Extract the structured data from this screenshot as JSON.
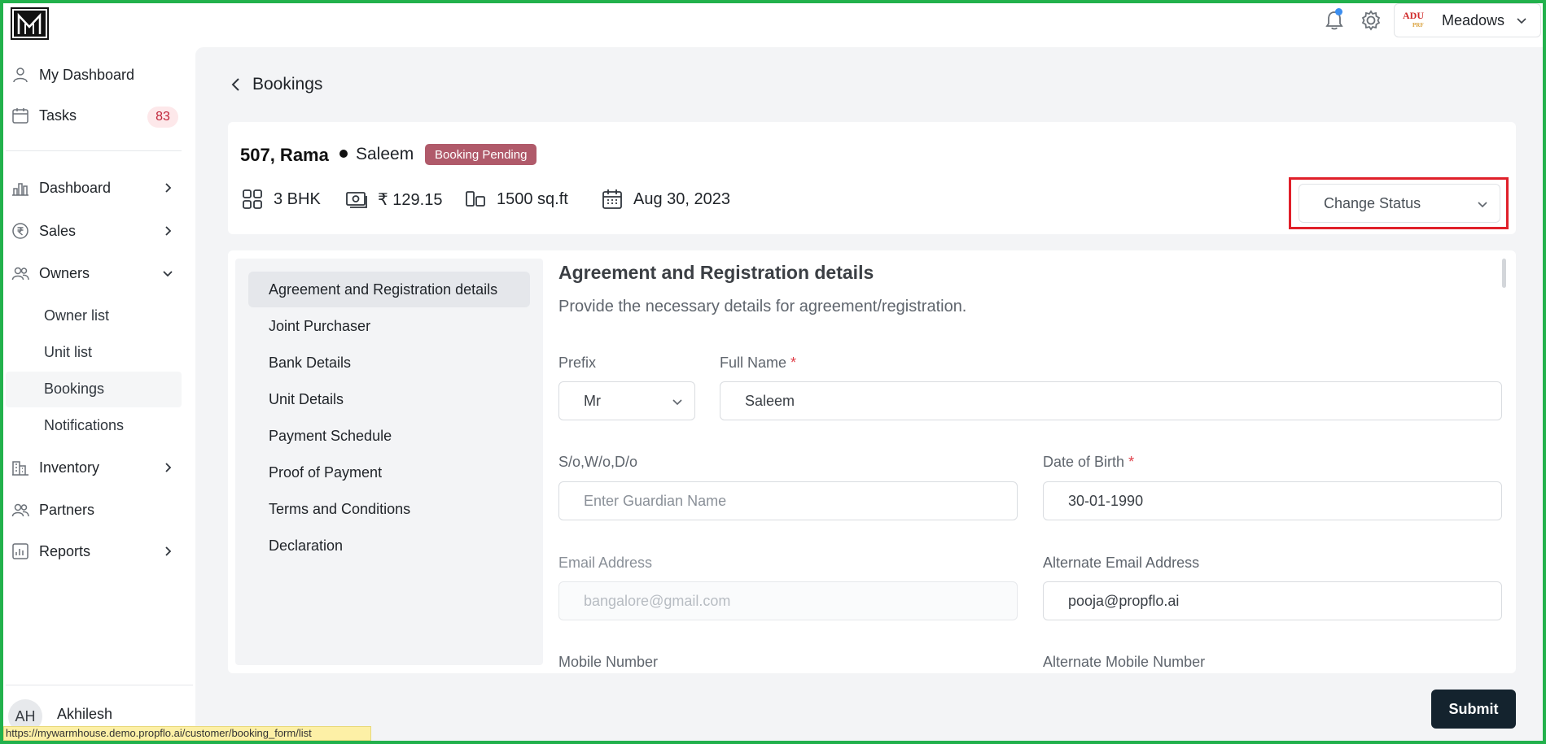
{
  "topbar": {
    "project": {
      "logo_text": "ADU",
      "logo_sub": "PRF",
      "name": "Meadows"
    }
  },
  "sidebar": {
    "my_dashboard": "My Dashboard",
    "tasks": {
      "label": "Tasks",
      "count": "83"
    },
    "items": [
      {
        "label": "Dashboard",
        "icon": "bar-chart-icon"
      },
      {
        "label": "Sales",
        "icon": "rupee-icon"
      },
      {
        "label": "Owners",
        "icon": "users-icon"
      },
      {
        "label": "Inventory",
        "icon": "building-icon"
      },
      {
        "label": "Partners",
        "icon": "users-icon"
      },
      {
        "label": "Reports",
        "icon": "report-icon"
      }
    ],
    "owners_sub": [
      "Owner list",
      "Unit list",
      "Bookings",
      "Notifications"
    ],
    "user": {
      "initials": "AH",
      "name": "Akhilesh"
    },
    "status_url": "https://mywarmhouse.demo.propflo.ai/customer/booking_form/list"
  },
  "page": {
    "title": "Bookings"
  },
  "booking": {
    "unit": "507, Rama",
    "owner": "Saleem",
    "status_badge": "Booking Pending",
    "bhk": "3 BHK",
    "price": "₹ 129.15",
    "area": "1500 sq.ft",
    "date": "Aug 30, 2023",
    "change_status": "Change Status"
  },
  "steps": [
    "Agreement and Registration details",
    "Joint Purchaser",
    "Bank Details",
    "Unit Details",
    "Payment Schedule",
    "Proof of Payment",
    "Terms and Conditions",
    "Declaration"
  ],
  "form": {
    "title": "Agreement and Registration details",
    "subtitle": "Provide the necessary details for agreement/registration.",
    "prefix": {
      "label": "Prefix",
      "value": "Mr"
    },
    "full_name": {
      "label": "Full Name",
      "value": "Saleem"
    },
    "guardian": {
      "label": "S/o,W/o,D/o",
      "placeholder": "Enter Guardian Name"
    },
    "dob": {
      "label": "Date of Birth",
      "value": "30-01-1990"
    },
    "email": {
      "label": "Email Address",
      "value": "bangalore@gmail.com"
    },
    "alt_email": {
      "label": "Alternate Email Address",
      "value": "pooja@propflo.ai"
    },
    "mobile": {
      "label": "Mobile Number"
    },
    "alt_mobile": {
      "label": "Alternate Mobile Number"
    },
    "required_mark": "*"
  },
  "actions": {
    "submit": "Submit"
  },
  "colors": {
    "accent_badge": "#b05a6a",
    "submit_bg": "#14232e",
    "highlight": "#e0202a"
  }
}
